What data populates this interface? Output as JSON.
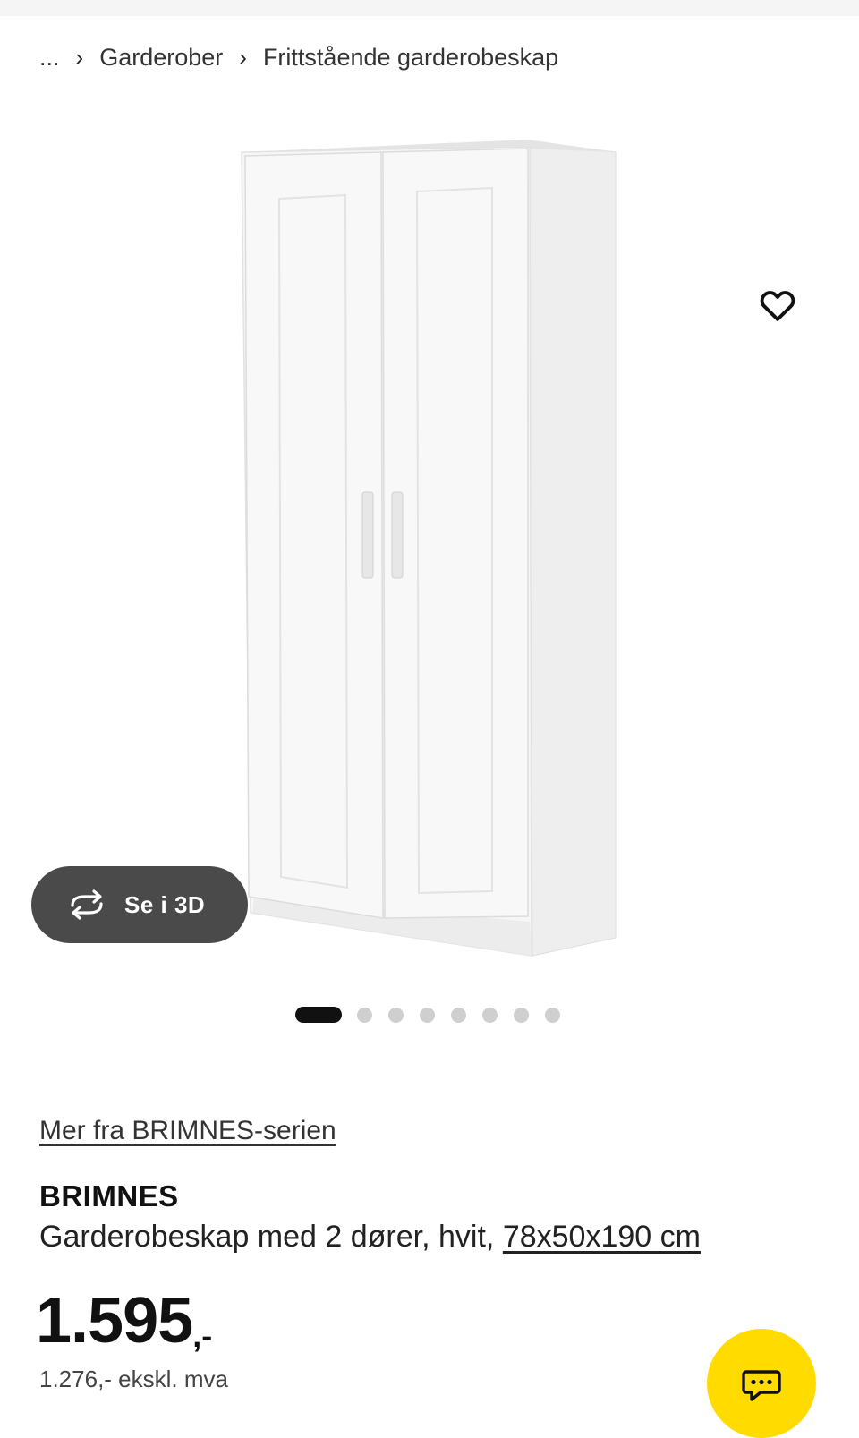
{
  "breadcrumb": {
    "ellipsis": "...",
    "items": [
      {
        "label": "Garderober"
      },
      {
        "label": "Frittstående garderobeskap"
      }
    ]
  },
  "gallery": {
    "image_alt": "BRIMNES garderobeskap med 2 dører, hvit",
    "view_3d_label": "Se i 3D",
    "total_images": 8,
    "active_index": 0
  },
  "product": {
    "series_link": "Mer fra BRIMNES-serien",
    "name": "BRIMNES",
    "description": "Garderobeskap med 2 dører, hvit,",
    "dimensions": "78x50x190 cm",
    "price": "1.595",
    "price_suffix": ",-",
    "price_ex_vat": "1.276,- ekskl. mva"
  },
  "colors": {
    "accent_yellow": "#ffdb00",
    "button_dark": "#4a4a4a",
    "text": "#111111"
  },
  "icons": {
    "favorite": "heart-icon",
    "view3d": "rotate-3d-icon",
    "chat": "chat-icon",
    "separator": "chevron-right-icon"
  }
}
